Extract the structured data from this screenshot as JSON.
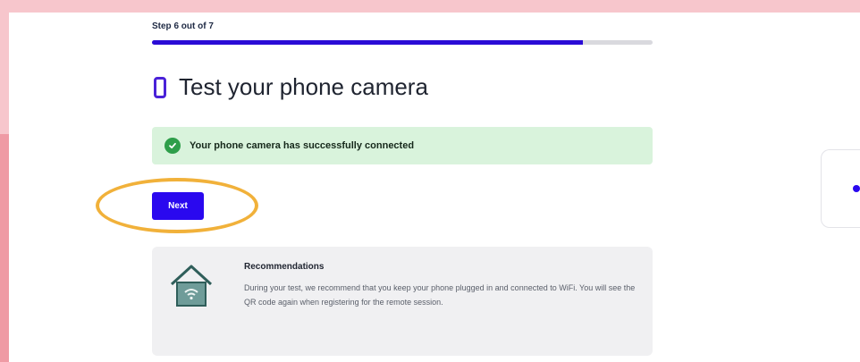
{
  "step": {
    "label": "Step 6 out of 7",
    "progress": 0.86
  },
  "title": {
    "icon": "smartphone-icon",
    "text": "Test your phone camera"
  },
  "success": {
    "icon": "check-circle-icon",
    "message": "Your phone camera has successfully connected"
  },
  "next_button": {
    "label": "Next"
  },
  "recommendations": {
    "icon": "home-wifi-icon",
    "title": "Recommendations",
    "body": "During your test, we recommend that you keep your phone plugged in and connected to WiFi. You will see the QR code again when registering for the remote session."
  },
  "colors": {
    "accent": "#2a08ef",
    "success_bg": "#d9f3dc",
    "highlight": "#f1b13a"
  }
}
